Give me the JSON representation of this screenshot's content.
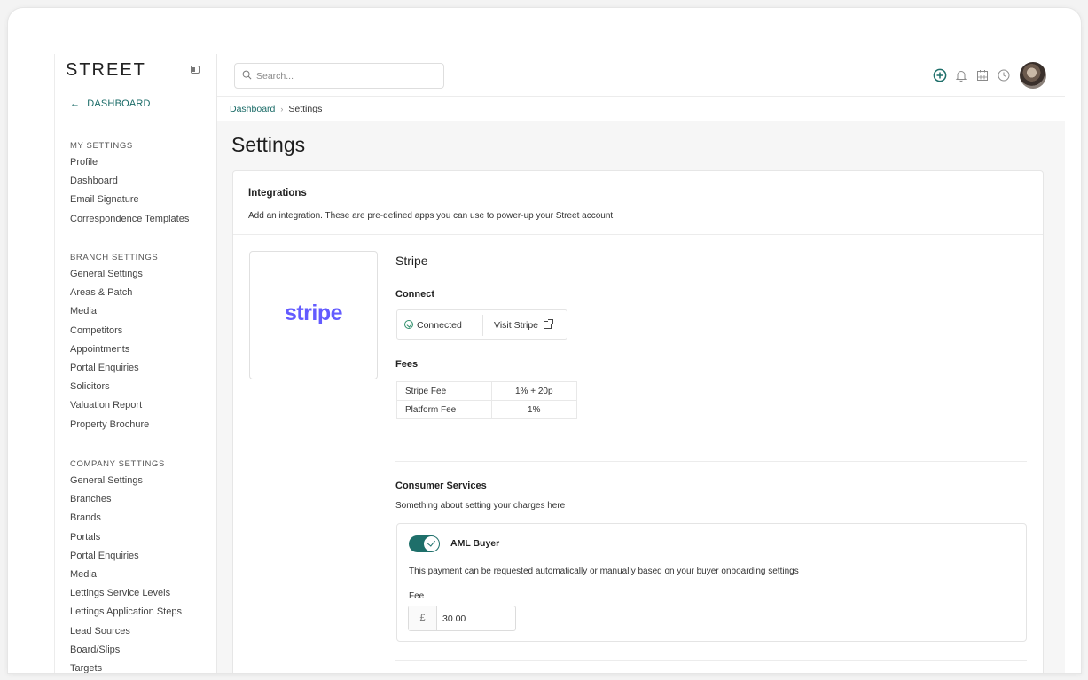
{
  "brand": {
    "logo": "STREET",
    "accent": "#1e6f6a"
  },
  "sidebar": {
    "back_label": "DASHBOARD",
    "sections": [
      {
        "heading": "MY SETTINGS",
        "items": [
          "Profile",
          "Dashboard",
          "Email Signature",
          "Correspondence Templates"
        ]
      },
      {
        "heading": "BRANCH SETTINGS",
        "items": [
          "General Settings",
          "Areas & Patch",
          "Media",
          "Competitors",
          "Appointments",
          "Portal Enquiries",
          "Solicitors",
          "Valuation Report",
          "Property Brochure"
        ]
      },
      {
        "heading": "COMPANY SETTINGS",
        "items": [
          "General Settings",
          "Branches",
          "Brands",
          "Portals",
          "Portal Enquiries",
          "Media",
          "Lettings Service Levels",
          "Lettings Application Steps",
          "Lead Sources",
          "Board/Slips",
          "Targets"
        ]
      }
    ]
  },
  "topbar": {
    "search_placeholder": "Search...",
    "icons": [
      "add-circle-icon",
      "bell-icon",
      "calendar-icon",
      "clock-icon"
    ]
  },
  "breadcrumb": {
    "parent": "Dashboard",
    "current": "Settings"
  },
  "page": {
    "title": "Settings"
  },
  "integrations": {
    "title": "Integrations",
    "description": "Add an integration. These are pre-defined apps you can use to power-up your Street account."
  },
  "stripe": {
    "logo_text": "stripe",
    "logo_color": "#635bff",
    "name": "Stripe",
    "connect_title": "Connect",
    "connected_label": "Connected",
    "visit_label": "Visit Stripe",
    "fees_title": "Fees",
    "fees": [
      {
        "label": "Stripe Fee",
        "value": "1% + 20p"
      },
      {
        "label": "Platform Fee",
        "value": "1%"
      }
    ]
  },
  "consumer_services": {
    "title": "Consumer Services",
    "description": "Something about setting your charges here",
    "aml": {
      "label": "AML Buyer",
      "enabled": true,
      "description": "This payment can be requested automatically or manually based on your buyer onboarding settings",
      "fee_label": "Fee",
      "currency": "£",
      "fee_value": "30.00"
    }
  }
}
